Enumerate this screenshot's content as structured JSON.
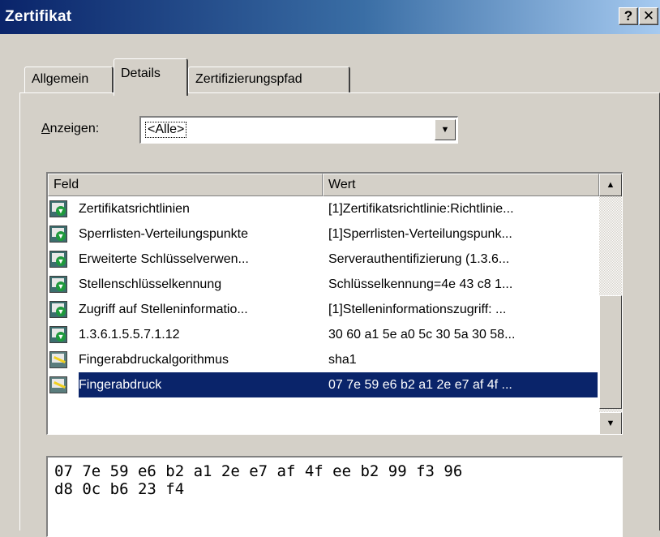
{
  "window": {
    "title": "Zertifikat",
    "help_label": "?",
    "close_label": "✕"
  },
  "tabs": [
    {
      "label": "Allgemein"
    },
    {
      "label": "Details"
    },
    {
      "label": "Zertifizierungspfad"
    }
  ],
  "show": {
    "label_accel": "A",
    "label_rest": "nzeigen:",
    "value": "<Alle>",
    "arrow": "▼"
  },
  "list": {
    "columns": {
      "field": "Feld",
      "value": "Wert"
    },
    "rows": [
      {
        "field": "Zertifikatsrichtlinien",
        "value": "[1]Zertifikatsrichtlinie:Richtlinie...",
        "icon": "cert-extension-icon"
      },
      {
        "field": "Sperrlisten-Verteilungspunkte",
        "value": "[1]Sperrlisten-Verteilungspunk...",
        "icon": "cert-extension-icon"
      },
      {
        "field": "Erweiterte Schlüsselverwen...",
        "value": "Serverauthentifizierung (1.3.6...",
        "icon": "cert-extension-icon"
      },
      {
        "field": "Stellenschlüsselkennung",
        "value": "Schlüsselkennung=4e 43 c8 1...",
        "icon": "cert-extension-icon"
      },
      {
        "field": "Zugriff auf Stelleninformatio...",
        "value": "[1]Stelleninformationszugriff: ...",
        "icon": "cert-extension-icon"
      },
      {
        "field": "1.3.6.1.5.5.7.1.12",
        "value": "30 60 a1 5e a0 5c 30 5a 30 58...",
        "icon": "cert-extension-icon"
      },
      {
        "field": "Fingerabdruckalgorithmus",
        "value": "sha1",
        "icon": "thumbprint-icon"
      },
      {
        "field": "Fingerabdruck",
        "value": "07 7e 59 e6 b2 a1 2e e7 af 4f ...",
        "icon": "thumbprint-icon",
        "selected": true
      }
    ],
    "scroll_up": "▲",
    "scroll_down": "▼"
  },
  "detail_value": "07 7e 59 e6 b2 a1 2e e7 af 4f ee b2 99 f3 96\nd8 0c b6 23 f4"
}
